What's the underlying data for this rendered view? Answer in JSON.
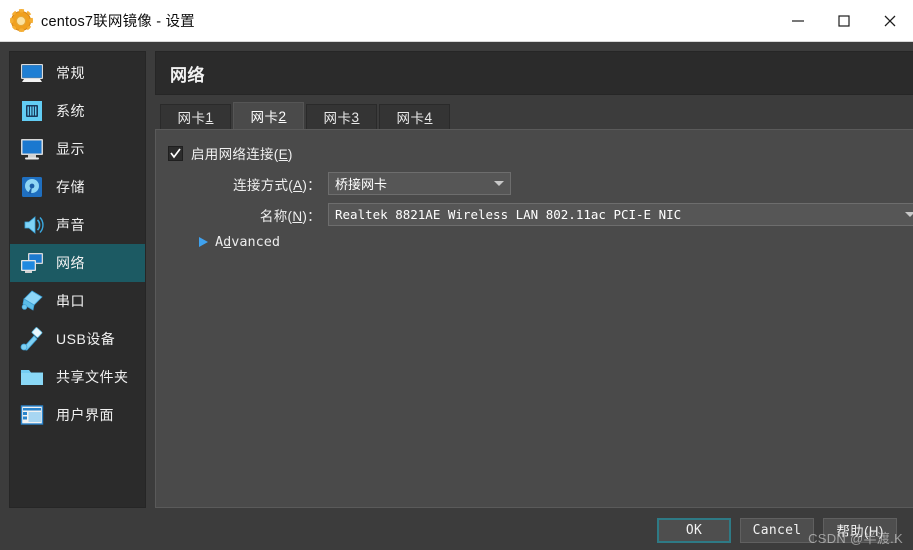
{
  "window": {
    "title": "centos7联网镜像 - 设置",
    "app_icon": "virtualbox-icon",
    "minimize_label": "—",
    "maximize_label": "□",
    "close_label": "✕"
  },
  "sidebar": {
    "items": [
      {
        "label": "常规",
        "icon": "monitor-general-icon",
        "selected": false
      },
      {
        "label": "系统",
        "icon": "chip-system-icon",
        "selected": false
      },
      {
        "label": "显示",
        "icon": "display-icon",
        "selected": false
      },
      {
        "label": "存储",
        "icon": "harddisk-storage-icon",
        "selected": false
      },
      {
        "label": "声音",
        "icon": "speaker-audio-icon",
        "selected": false
      },
      {
        "label": "网络",
        "icon": "network-icon",
        "selected": true
      },
      {
        "label": "串口",
        "icon": "serial-port-icon",
        "selected": false
      },
      {
        "label": "USB设备",
        "icon": "usb-icon",
        "selected": false
      },
      {
        "label": "共享文件夹",
        "icon": "folder-shared-icon",
        "selected": false
      },
      {
        "label": "用户界面",
        "icon": "user-interface-icon",
        "selected": false
      }
    ]
  },
  "page": {
    "title": "网络"
  },
  "tabs": [
    {
      "label": "网卡 ",
      "accel": "1",
      "active": false
    },
    {
      "label": "网卡 ",
      "accel": "2",
      "active": true
    },
    {
      "label": "网卡 ",
      "accel": "3",
      "active": false
    },
    {
      "label": "网卡 ",
      "accel": "4",
      "active": false
    }
  ],
  "form": {
    "enable_adapter": {
      "label": "启用网络连接(",
      "accel": "E",
      "label_tail": ")",
      "checked": true
    },
    "attached_to": {
      "label": "连接方式(",
      "accel": "A",
      "label_tail": ")：",
      "value": "桥接网卡"
    },
    "name": {
      "label": "名称(",
      "accel": "N",
      "label_tail": ")：",
      "value": "Realtek 8821AE Wireless LAN 802.11ac PCI-E NIC"
    },
    "advanced": {
      "label_pre": "A",
      "accel": "d",
      "label_post": "vanced",
      "expanded": false
    }
  },
  "footer": {
    "ok_label": "OK",
    "cancel_label": "Cancel",
    "help_label": "帮助(H)"
  },
  "watermark": {
    "text": "CSDN @半渡.K"
  },
  "colors": {
    "accent_selected": "#1c5a63",
    "panel_bg": "#4a4a4a",
    "sidebar_bg": "#2b2b2b",
    "window_bg": "#3c3c3c",
    "header_bg": "#2b2b2b",
    "advanced_triangle": "#3fa2ef",
    "default_button_border": "#2e7a85"
  }
}
